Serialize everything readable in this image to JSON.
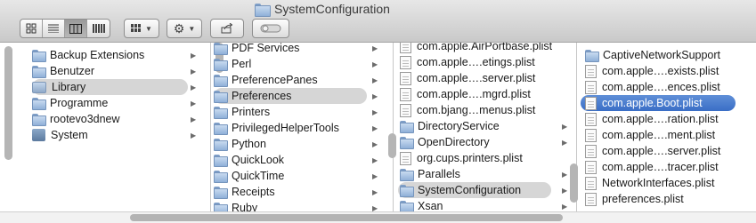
{
  "window": {
    "title": "SystemConfiguration"
  },
  "toolbar": {
    "view_buttons": [
      {
        "name": "icon-view-button",
        "icon": "icon-grid-icon",
        "active": false
      },
      {
        "name": "list-view-button",
        "icon": "list-lines-icon",
        "active": false
      },
      {
        "name": "column-view-button",
        "icon": "columns-icon",
        "active": true
      },
      {
        "name": "coverflow-view-button",
        "icon": "coverflow-icon",
        "active": false
      }
    ],
    "arrange_icon": "arrange-grid-icon",
    "action_icon": "gear-icon",
    "share_icon": "share-icon",
    "tag_icon": "tag-toggle-icon"
  },
  "columns": [
    {
      "items": [
        {
          "label": "Backup Extensions",
          "icon": "folder",
          "arrow": true
        },
        {
          "label": "Benutzer",
          "icon": "folder",
          "arrow": true
        },
        {
          "label": "Library",
          "icon": "library",
          "arrow": true,
          "selected": "grey"
        },
        {
          "label": "Programme",
          "icon": "folder",
          "arrow": true
        },
        {
          "label": "rootevo3dnew",
          "icon": "folder",
          "arrow": true
        },
        {
          "label": "System",
          "icon": "system",
          "arrow": true
        }
      ]
    },
    {
      "items": [
        {
          "label": "PDF Services",
          "icon": "folder",
          "arrow": true,
          "clipped": true
        },
        {
          "label": "Perl",
          "icon": "folder",
          "arrow": true
        },
        {
          "label": "PreferencePanes",
          "icon": "folder",
          "arrow": true
        },
        {
          "label": "Preferences",
          "icon": "folder",
          "arrow": true,
          "selected": "grey"
        },
        {
          "label": "Printers",
          "icon": "folder",
          "arrow": true
        },
        {
          "label": "PrivilegedHelperTools",
          "icon": "folder",
          "arrow": true
        },
        {
          "label": "Python",
          "icon": "folder",
          "arrow": true
        },
        {
          "label": "QuickLook",
          "icon": "folder",
          "arrow": true
        },
        {
          "label": "QuickTime",
          "icon": "folder",
          "arrow": true
        },
        {
          "label": "Receipts",
          "icon": "folder",
          "arrow": true
        },
        {
          "label": "Ruby",
          "icon": "folder",
          "arrow": true,
          "clipped": true
        }
      ]
    },
    {
      "items": [
        {
          "label": "com.apple.AirPortbase.plist",
          "icon": "doc",
          "arrow": false,
          "clipped": true
        },
        {
          "label": "com.apple….etings.plist",
          "icon": "doc",
          "arrow": false
        },
        {
          "label": "com.apple….server.plist",
          "icon": "doc",
          "arrow": false
        },
        {
          "label": "com.apple….mgrd.plist",
          "icon": "doc",
          "arrow": false
        },
        {
          "label": "com.bjang…menus.plist",
          "icon": "doc",
          "arrow": false
        },
        {
          "label": "DirectoryService",
          "icon": "folder",
          "arrow": true
        },
        {
          "label": "OpenDirectory",
          "icon": "folder",
          "arrow": true
        },
        {
          "label": "org.cups.printers.plist",
          "icon": "doc",
          "arrow": false
        },
        {
          "label": "Parallels",
          "icon": "folder",
          "arrow": true
        },
        {
          "label": "SystemConfiguration",
          "icon": "folder",
          "arrow": true,
          "selected": "grey"
        },
        {
          "label": "Xsan",
          "icon": "folder",
          "arrow": true,
          "clipped": true
        }
      ]
    },
    {
      "items": [
        {
          "label": "CaptiveNetworkSupport",
          "icon": "folder",
          "arrow": true
        },
        {
          "label": "com.apple….exists.plist",
          "icon": "doc",
          "arrow": false
        },
        {
          "label": "com.apple….ences.plist",
          "icon": "doc",
          "arrow": false
        },
        {
          "label": "com.apple.Boot.plist",
          "icon": "doc",
          "arrow": false,
          "selected": "blue"
        },
        {
          "label": "com.apple….ration.plist",
          "icon": "doc",
          "arrow": false
        },
        {
          "label": "com.apple….ment.plist",
          "icon": "doc",
          "arrow": false
        },
        {
          "label": "com.apple….server.plist",
          "icon": "doc",
          "arrow": false
        },
        {
          "label": "com.apple….tracer.plist",
          "icon": "doc",
          "arrow": false
        },
        {
          "label": "NetworkInterfaces.plist",
          "icon": "doc",
          "arrow": false
        },
        {
          "label": "preferences.plist",
          "icon": "doc",
          "arrow": false
        }
      ]
    }
  ]
}
